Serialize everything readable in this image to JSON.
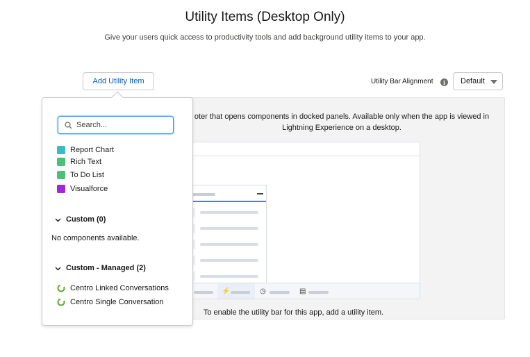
{
  "header": {
    "title": "Utility Items (Desktop Only)",
    "subtitle": "Give your users quick access to productivity tools and add background utility items to your app."
  },
  "toolbar": {
    "add_label": "Add Utility Item",
    "alignment_label": "Utility Bar Alignment",
    "alignment_value": "Default"
  },
  "description": {
    "line1": "oter that opens components in docked panels. Available only when the app is viewed in",
    "line2": "Lightning Experience on a desktop."
  },
  "empty_hint": "To enable the utility bar for this app, add a utility item.",
  "popover": {
    "search_placeholder": "Search...",
    "standard_items": [
      {
        "label": "Report Chart",
        "icon": "report-chart-icon",
        "color": "#3bb9c4"
      },
      {
        "label": "Rich Text",
        "icon": "rich-text-icon",
        "color": "#4bc076"
      },
      {
        "label": "To Do List",
        "icon": "todo-list-icon",
        "color": "#4bc076"
      },
      {
        "label": "Visualforce",
        "icon": "visualforce-icon",
        "color": "#9f29d6"
      }
    ],
    "sections": [
      {
        "title": "Custom (0)",
        "empty_text": "No components available."
      },
      {
        "title": "Custom - Managed (2)",
        "items": [
          {
            "label": "Centro Linked Conversations",
            "icon": "centro-icon",
            "color": "#5ba829"
          },
          {
            "label": "Centro Single Conversation",
            "icon": "centro-icon",
            "color": "#5ba829"
          }
        ]
      }
    ]
  },
  "colors": {
    "brand": "#0b5cab",
    "focus": "#1b96ff",
    "panel_bg": "#f3f3f3"
  }
}
